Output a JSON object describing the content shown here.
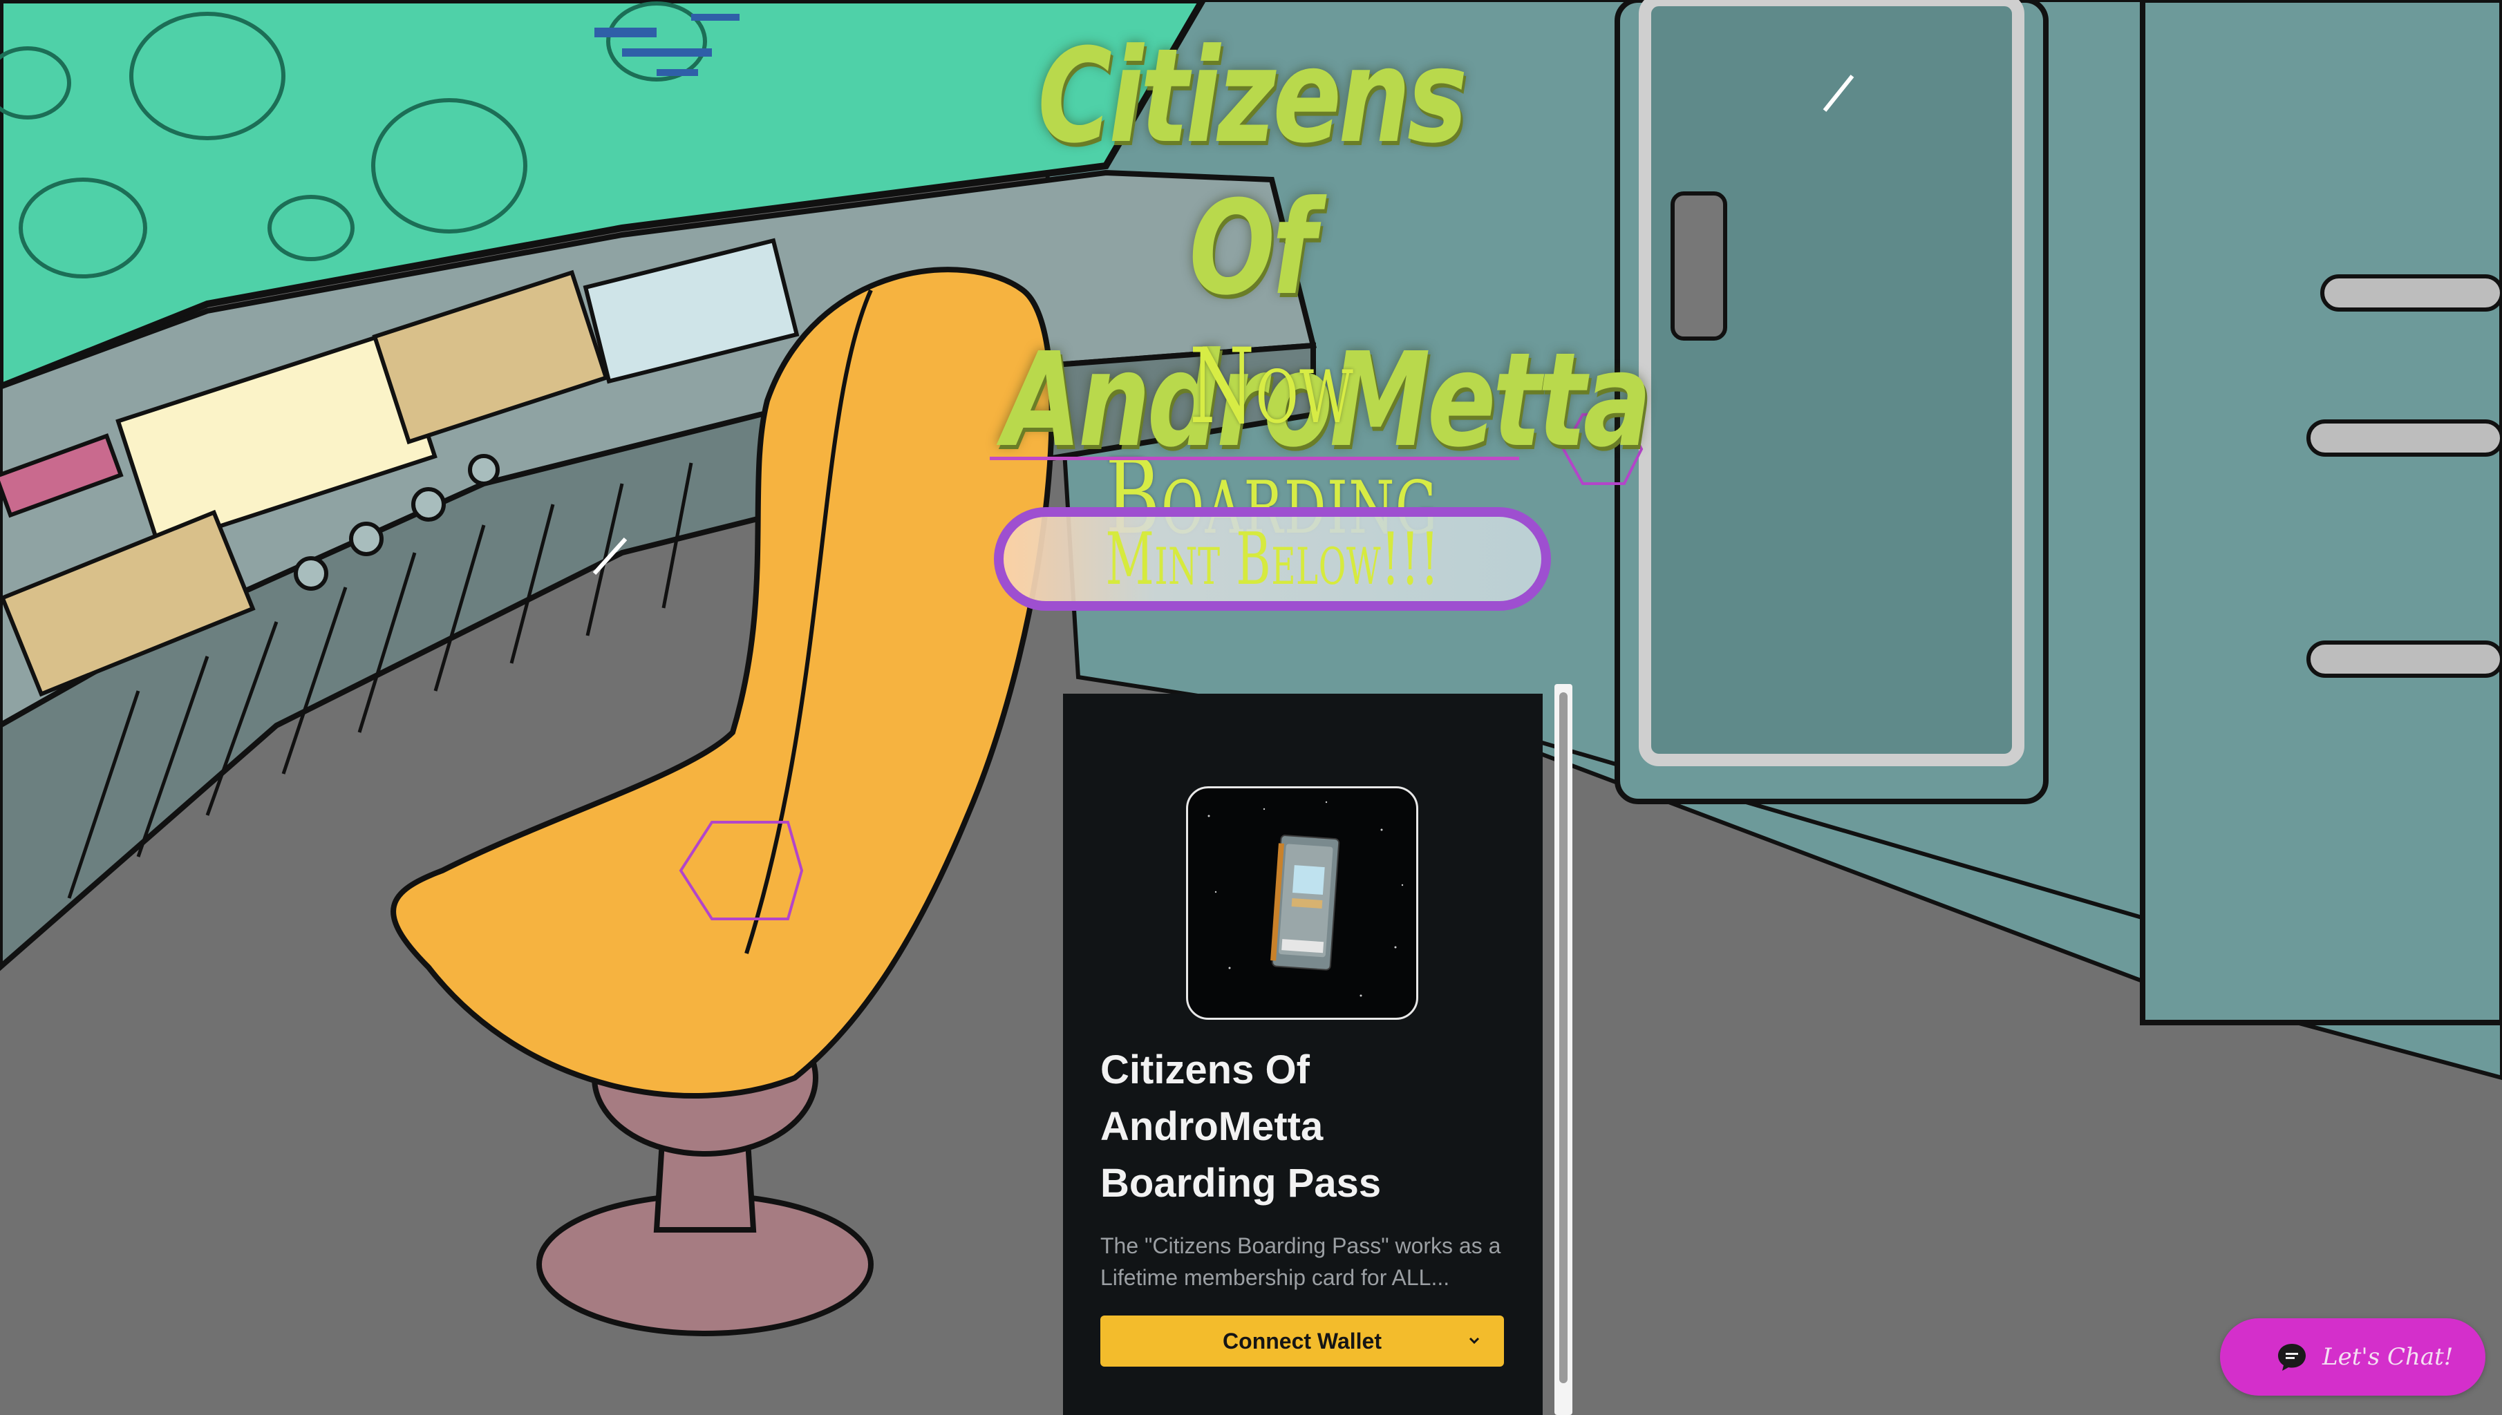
{
  "hero": {
    "title_line1": "Citizens Of",
    "title_line2": "AndroMetta",
    "subtitle": "Now Boarding"
  },
  "mint": {
    "button_label": "Mint Below!!!"
  },
  "card": {
    "title_lines": [
      "Citizens Of",
      "AndroMetta",
      "Boarding Pass"
    ],
    "description_line1": "The \"Citizens Boarding Pass\" works as a",
    "description_line2": "Lifetime membership card for ALL...",
    "wallet_button_label": "Connect Wallet",
    "wallet_chevron_icon": "chevron-down-icon"
  },
  "chat": {
    "label": "Let's Chat!",
    "icon": "chat-bubble-icon"
  },
  "colors": {
    "title_green": "#b9d94c",
    "boarding_yellow": "#d7ec45",
    "accent_purple": "#9e4fd0",
    "divider_magenta": "#c04ac6",
    "wallet_yellow": "#f3bc2c",
    "chat_magenta": "#d42fcb",
    "card_bg": "#111416"
  }
}
